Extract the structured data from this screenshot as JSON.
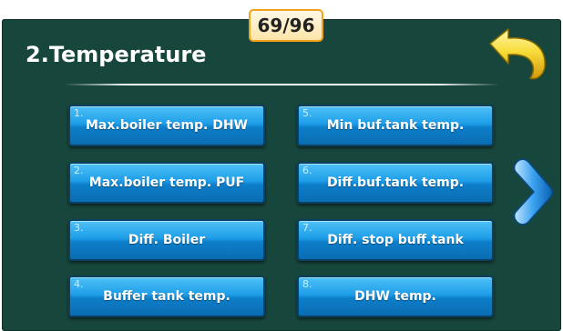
{
  "header": {
    "page_counter": "69/96",
    "title": "2.Temperature"
  },
  "navigation": {
    "back_icon": "back-arrow-icon",
    "next_icon": "chevron-right-icon"
  },
  "menu": {
    "items": [
      {
        "number": "1.",
        "label": "Max.boiler temp. DHW"
      },
      {
        "number": "2.",
        "label": "Max.boiler temp. PUF"
      },
      {
        "number": "3.",
        "label": "Diff. Boiler"
      },
      {
        "number": "4.",
        "label": "Buffer tank temp."
      },
      {
        "number": "5.",
        "label": "Min buf.tank temp."
      },
      {
        "number": "6.",
        "label": "Diff.buf.tank temp."
      },
      {
        "number": "7.",
        "label": "Diff. stop buff.tank"
      },
      {
        "number": "8.",
        "label": "DHW temp."
      }
    ]
  },
  "colors": {
    "background": "#17463c",
    "button": "#1e9ee8",
    "badge_border": "#f2a11a",
    "back_arrow": "#f6d22a",
    "next_arrow": "#2a8fe0"
  }
}
